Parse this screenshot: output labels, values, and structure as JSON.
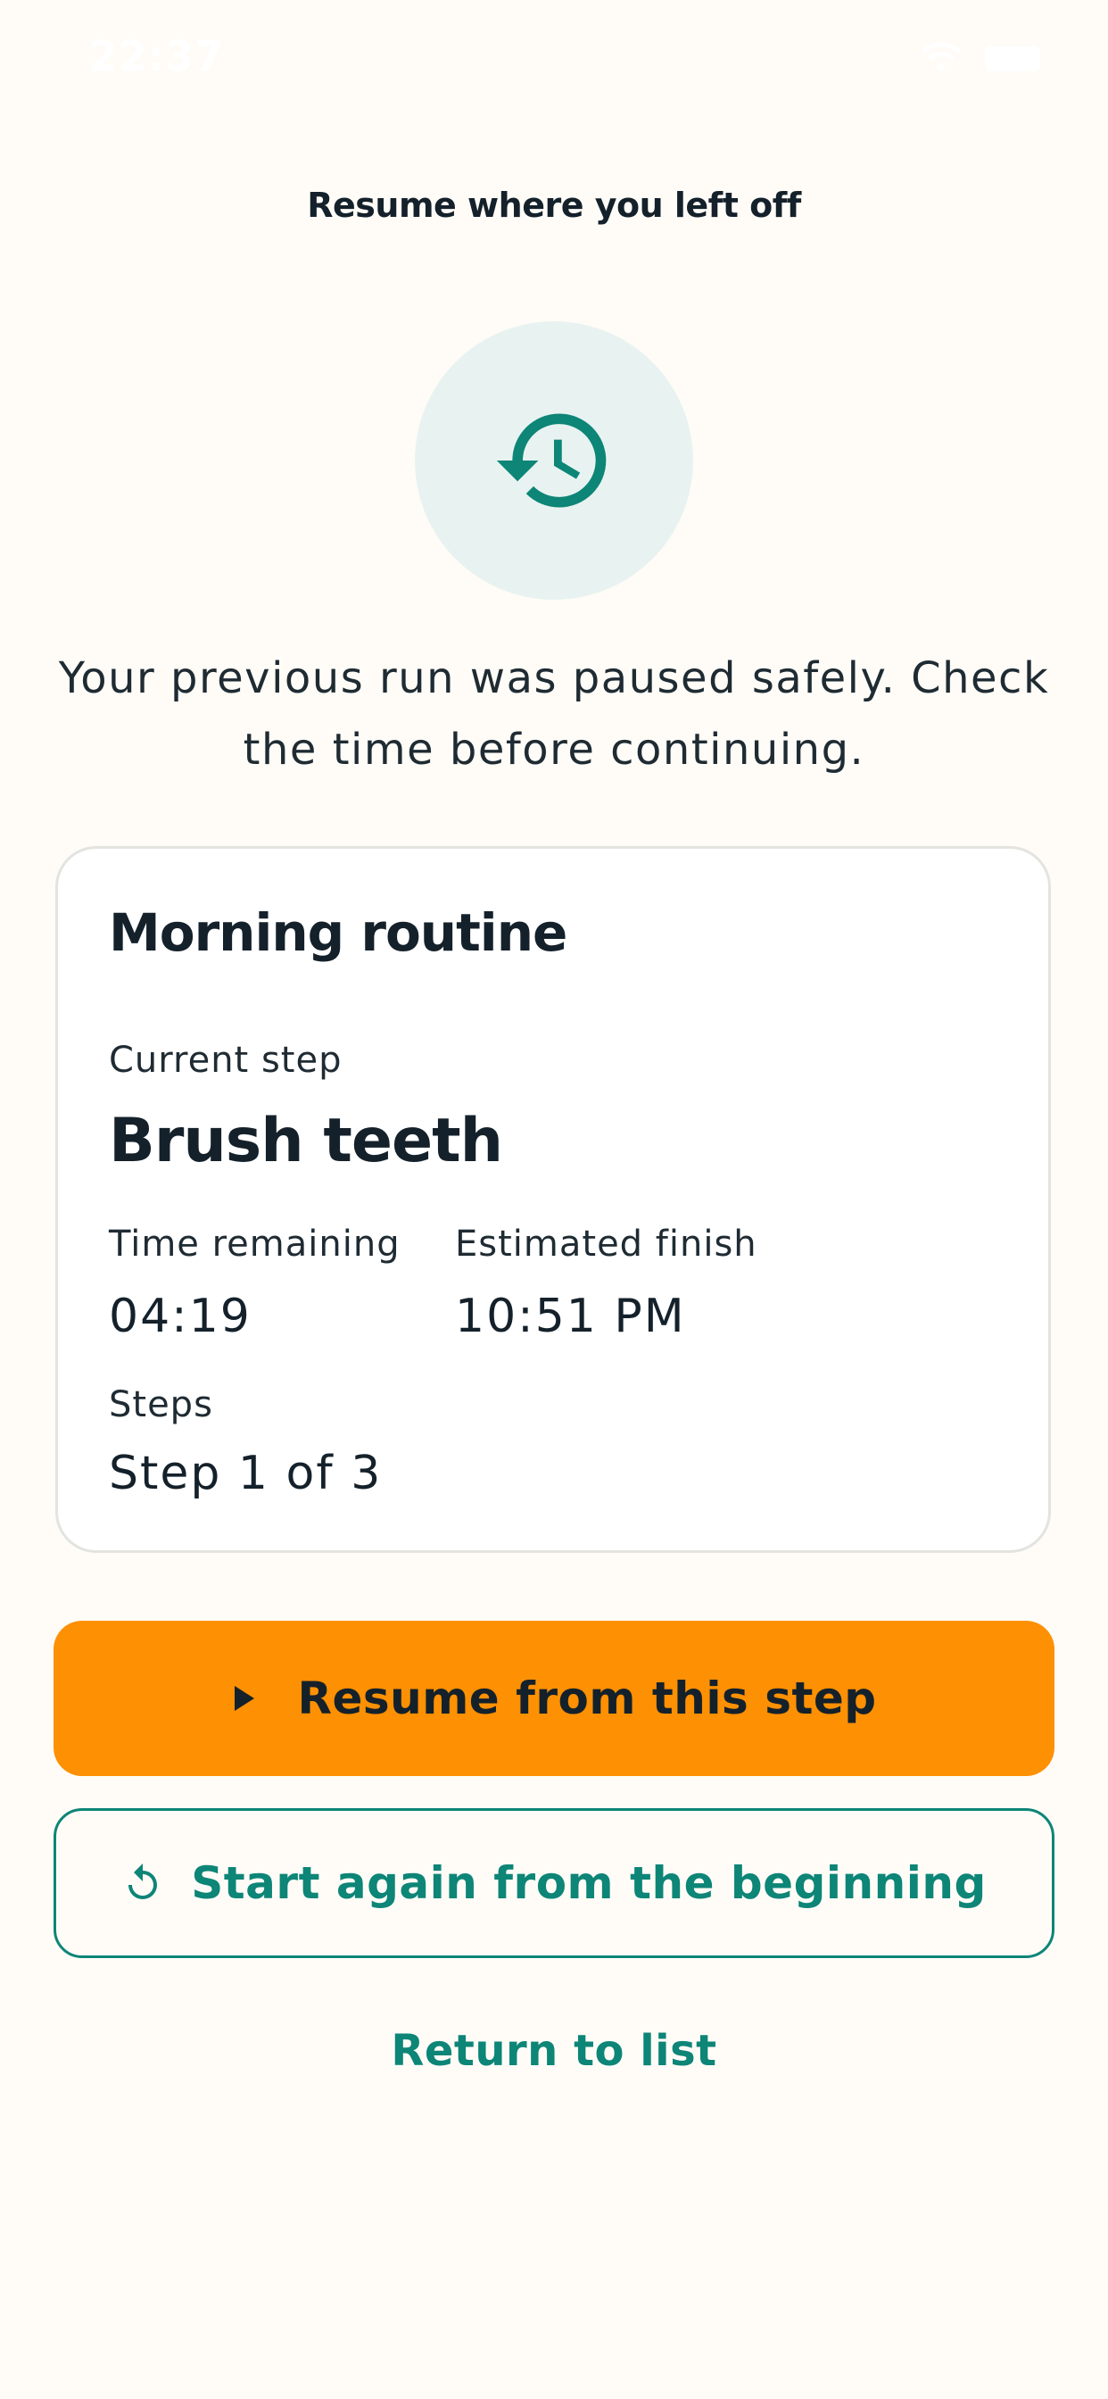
{
  "status_bar": {
    "time": "22:37"
  },
  "header": {
    "title": "Resume where you left off"
  },
  "hero": {
    "icon": "history-icon",
    "message": "Your previous run was paused safely. Check the time before continuing."
  },
  "card": {
    "routine_name": "Morning routine",
    "current_step_label": "Current step",
    "current_step_value": "Brush teeth",
    "time_remaining_label": "Time remaining",
    "time_remaining_value": "04:19",
    "estimated_finish_label": "Estimated finish",
    "estimated_finish_value": "10:51 PM",
    "steps_label": "Steps",
    "steps_value": "Step 1 of 3"
  },
  "actions": {
    "resume_label": "Resume from this step",
    "restart_label": "Start again from the beginning",
    "return_label": "Return to list"
  },
  "colors": {
    "background": "#fffcf7",
    "accent_orange": "#fd9003",
    "accent_teal": "#0d8577",
    "hero_circle": "#e8f3f1",
    "text_dark": "#14212b"
  }
}
